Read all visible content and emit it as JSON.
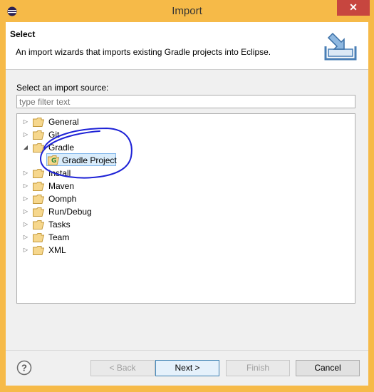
{
  "window": {
    "title": "Import",
    "close_label": "✕"
  },
  "banner": {
    "title": "Select",
    "description": "An import wizards that imports existing Gradle projects into Eclipse."
  },
  "source": {
    "label": "Select an import source:",
    "filter_placeholder": "type filter text"
  },
  "tree": {
    "items": [
      {
        "label": "General",
        "expanded": false
      },
      {
        "label": "Git",
        "expanded": false
      },
      {
        "label": "Gradle",
        "expanded": true
      },
      {
        "label": "Gradle Project",
        "child": true,
        "selected": true
      },
      {
        "label": "Install",
        "expanded": false
      },
      {
        "label": "Maven",
        "expanded": false
      },
      {
        "label": "Oomph",
        "expanded": false
      },
      {
        "label": "Run/Debug",
        "expanded": false
      },
      {
        "label": "Tasks",
        "expanded": false
      },
      {
        "label": "Team",
        "expanded": false
      },
      {
        "label": "XML",
        "expanded": false
      }
    ]
  },
  "buttons": {
    "help": "?",
    "back": "< Back",
    "next": "Next >",
    "finish": "Finish",
    "cancel": "Cancel"
  },
  "colors": {
    "title_bar": "#f6ba48",
    "close": "#c7463f",
    "selection": "#d9ecfb",
    "annotation": "#1e22d6"
  }
}
